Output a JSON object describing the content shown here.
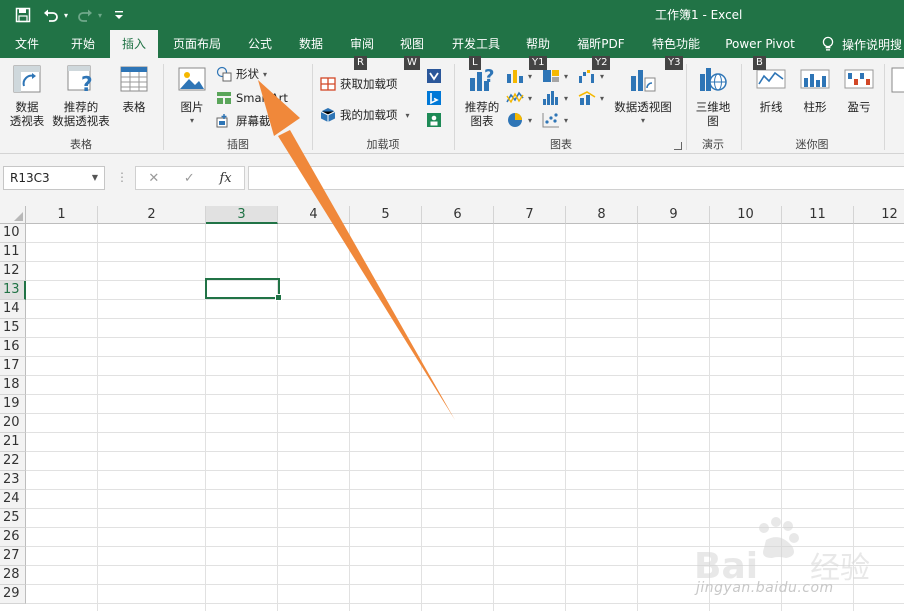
{
  "window": {
    "title": "工作簿1  -  Excel"
  },
  "tabs": [
    {
      "label": "文件"
    },
    {
      "label": "开始"
    },
    {
      "label": "插入"
    },
    {
      "label": "页面布局"
    },
    {
      "label": "公式"
    },
    {
      "label": "数据"
    },
    {
      "label": "审阅"
    },
    {
      "label": "视图"
    },
    {
      "label": "开发工具"
    },
    {
      "label": "帮助"
    },
    {
      "label": "福昕PDF"
    },
    {
      "label": "特色功能"
    },
    {
      "label": "Power Pivot"
    }
  ],
  "active_tab": "插入",
  "tell_me": "操作说明搜",
  "ribbon": {
    "tables": {
      "label": "表格",
      "pivot": "数据\n透视表",
      "recommended_pivot": "推荐的\n数据透视表",
      "table": "表格"
    },
    "illustrations": {
      "label": "插图",
      "pictures": "图片",
      "shapes": "形状",
      "smartart": "SmartArt",
      "screenshot": "屏幕截图"
    },
    "addins": {
      "label": "加载项",
      "get": "获取加载项",
      "my": "我的加载项"
    },
    "charts": {
      "label": "图表",
      "recommended": "推荐的\n图表",
      "pivotchart": "数据透视图"
    },
    "tours": {
      "label": "演示",
      "map3d": "三维地\n图"
    },
    "sparklines": {
      "label": "迷你图",
      "line": "折线",
      "column": "柱形",
      "winloss": "盈亏"
    }
  },
  "keytips": {
    "R": "R",
    "W": "W",
    "L": "L",
    "Y1": "Y1",
    "Y2": "Y2",
    "Y3": "Y3",
    "B": "B"
  },
  "formula_bar": {
    "name_box": "R13C3",
    "cancel": "✕",
    "enter": "✓",
    "fx": "fx",
    "value": ""
  },
  "columns": [
    "1",
    "2",
    "3",
    "4",
    "5",
    "6",
    "7",
    "8",
    "9",
    "10",
    "11",
    "12"
  ],
  "rows": [
    "10",
    "11",
    "12",
    "13",
    "14",
    "15",
    "16",
    "17",
    "18",
    "19",
    "20",
    "21",
    "22",
    "23",
    "24",
    "25",
    "26",
    "27",
    "28",
    "29"
  ],
  "selected": {
    "row": "13",
    "column": "3"
  },
  "watermark": {
    "text": "jingyan.baidu.com"
  },
  "colors": {
    "excel_green": "#217346",
    "arrow": "#f0883a"
  }
}
